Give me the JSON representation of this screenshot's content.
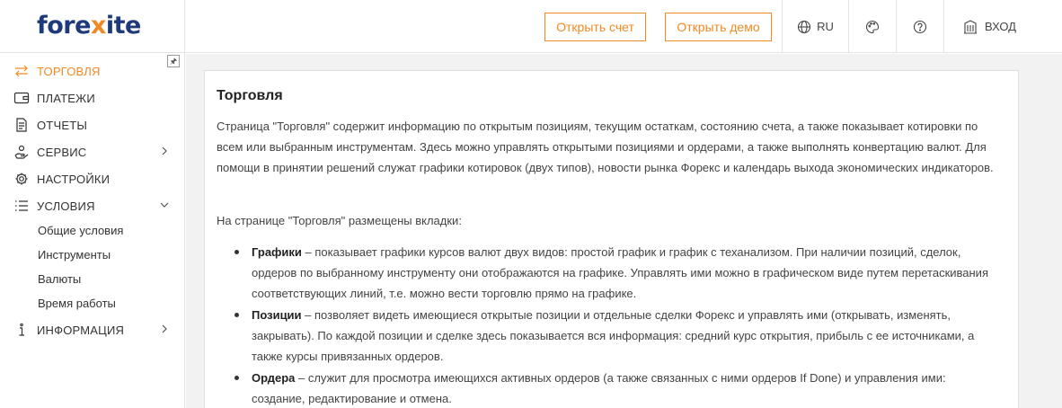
{
  "header": {
    "logo_pre": "fore",
    "logo_x": "x",
    "logo_post": "ite",
    "open_account": "Открыть счет",
    "open_demo": "Открыть демо",
    "language": "RU",
    "login": "ВХОД"
  },
  "sidebar": {
    "pin": "🖈",
    "items": [
      {
        "label": "ТОРГОВЛЯ",
        "icon": "exchange-arrows-icon"
      },
      {
        "label": "ПЛАТЕЖИ",
        "icon": "wallet-icon"
      },
      {
        "label": "ОТЧЕТЫ",
        "icon": "document-icon"
      },
      {
        "label": "СЕРВИС",
        "icon": "service-hand-icon"
      },
      {
        "label": "НАСТРОЙКИ",
        "icon": "gear-icon"
      },
      {
        "label": "УСЛОВИЯ",
        "icon": "list-icon"
      },
      {
        "label": "ИНФОРМАЦИЯ",
        "icon": "info-icon"
      }
    ],
    "subitems": [
      "Общие условия",
      "Инструменты",
      "Валюты",
      "Время работы"
    ]
  },
  "content": {
    "title": "Торговля",
    "intro": "Страница \"Торговля\" содержит информацию по открытым позициям, текущим остаткам, состоянию счета, а также показывает котировки по всем или выбранным инструментам. Здесь можно управлять открытыми позициями и ордерами, а также выполнять конвертацию валют. Для помощи в принятии решений служат графики котировок (двух типов), новости рынка Форекс и календарь выхода экономических индикаторов.",
    "tabs_intro": "На странице \"Торговля\" размещены вкладки:",
    "bullets": [
      {
        "term": "Графики",
        "text": " – показывает графики курсов валют двух видов: простой график и график с теханализом. При наличии позиций, сделок, ордеров по выбранному инструменту они отображаются на графике. Управлять ими можно в графическом виде путем перетаскивания соответствующих линий, т.е. можно вести торговлю прямо на графике."
      },
      {
        "term": "Позиции",
        "text": " – позволяет видеть имеющиеся открытые позиции и отдельные сделки Форекс и управлять ими (открывать, изменять, закрывать). По каждой позиции и сделке здесь показывается вся информация: средний курс открытия, прибыль с ее источниками, а также курсы привязанных ордеров."
      },
      {
        "term": "Ордера",
        "text": " – служит для просмотра имеющихся активных ордеров (а также связанных с ними ордеров If Done) и управления ими: создание, редактирование и отмена."
      }
    ]
  },
  "colors": {
    "accent": "#f08a24",
    "brand": "#1f3a7a"
  }
}
